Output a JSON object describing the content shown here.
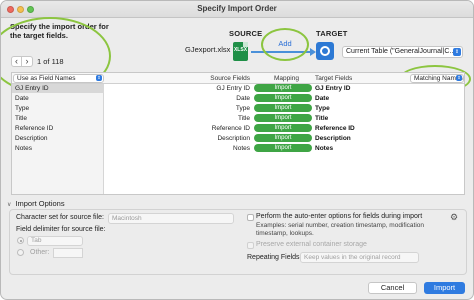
{
  "window": {
    "title": "Specify Import Order"
  },
  "description": "Specify the import order for the target fields.",
  "record_nav": {
    "prev": "‹",
    "next": "›",
    "text": "1 of 118"
  },
  "source": {
    "header": "SOURCE",
    "file": "GJexport.xlsx",
    "icon": "excel-file-icon",
    "icon_text": "XLSX"
  },
  "add_label": "Add",
  "target": {
    "header": "TARGET",
    "icon": "filemaker-table-icon",
    "selected": "Current Table (\"GeneralJournal|C..."
  },
  "grid": {
    "option_select": "Use as Field Names",
    "headers": {
      "source": "Source Fields",
      "mapping": "Mapping",
      "target": "Target Fields"
    },
    "matching": "Matching Names",
    "rows": [
      {
        "left": "GJ Entry ID",
        "source": "GJ Entry ID",
        "mapping": "Import",
        "target": "GJ Entry ID"
      },
      {
        "left": "Date",
        "source": "Date",
        "mapping": "Import",
        "target": "Date"
      },
      {
        "left": "Type",
        "source": "Type",
        "mapping": "Import",
        "target": "Type"
      },
      {
        "left": "Title",
        "source": "Title",
        "mapping": "Import",
        "target": "Title"
      },
      {
        "left": "Reference ID",
        "source": "Reference ID",
        "mapping": "Import",
        "target": "Reference ID"
      },
      {
        "left": "Description",
        "source": "Description",
        "mapping": "Import",
        "target": "Description"
      },
      {
        "left": "Notes",
        "source": "Notes",
        "mapping": "Import",
        "target": "Notes"
      }
    ]
  },
  "import_options": {
    "heading": "Import Options",
    "charset_label": "Character set for source file:",
    "charset_value": "Macintosh",
    "delimiter_label": "Field delimiter for source file:",
    "tab_value": "Tab",
    "other_label": "Other:",
    "autoenter_label": "Perform the auto-enter options for fields during import",
    "examples": "Examples: serial number, creation timestamp, modification timestamp, lookups.",
    "preserve_label": "Preserve external container storage",
    "repeating_label": "Repeating Fields:",
    "repeating_value": "Keep values in the original record"
  },
  "buttons": {
    "cancel": "Cancel",
    "import": "Import"
  },
  "colors": {
    "accent": "#2f7be0",
    "mapping_green": "#3fa545",
    "annotation_green": "#8cc540"
  }
}
